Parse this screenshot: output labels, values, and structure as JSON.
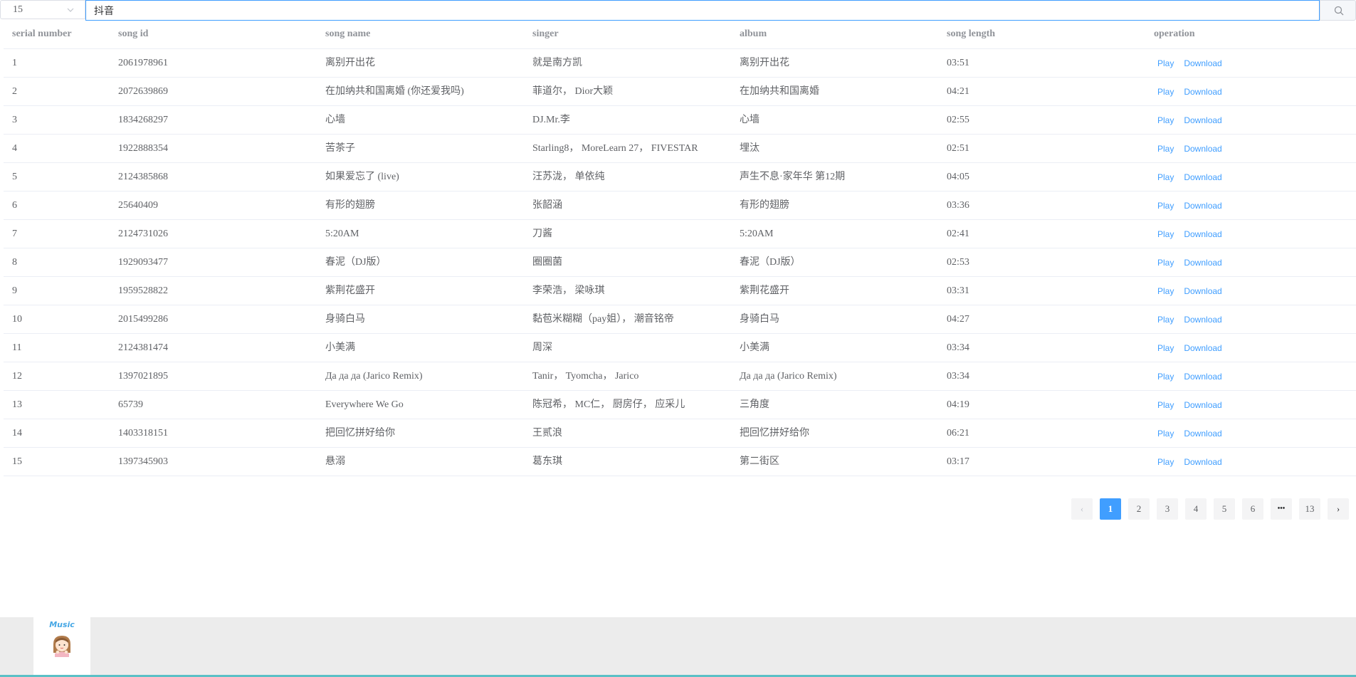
{
  "search": {
    "page_size_value": "15",
    "query": "抖音"
  },
  "table": {
    "headers": [
      "serial number",
      "song id",
      "song name",
      "singer",
      "album",
      "song length",
      "operation"
    ],
    "rows": [
      {
        "serial": "1",
        "id": "2061978961",
        "name": "离别开出花",
        "singer": "就是南方凯",
        "album": "离别开出花",
        "length": "03:51"
      },
      {
        "serial": "2",
        "id": "2072639869",
        "name": "在加纳共和国离婚 (你还爱我吗)",
        "singer": "菲道尔， Dior大颖",
        "album": "在加纳共和国离婚",
        "length": "04:21"
      },
      {
        "serial": "3",
        "id": "1834268297",
        "name": "心墙",
        "singer": "DJ.Mr.李",
        "album": "心墙",
        "length": "02:55"
      },
      {
        "serial": "4",
        "id": "1922888354",
        "name": "苦茶子",
        "singer": "Starling8， MoreLearn 27， FIVESTAR",
        "album": "埋汰",
        "length": "02:51"
      },
      {
        "serial": "5",
        "id": "2124385868",
        "name": "如果爱忘了 (live)",
        "singer": "汪苏泷， 单依纯",
        "album": "声生不息·家年华 第12期",
        "length": "04:05"
      },
      {
        "serial": "6",
        "id": "25640409",
        "name": "有形的翅膀",
        "singer": "张韶涵",
        "album": "有形的翅膀",
        "length": "03:36"
      },
      {
        "serial": "7",
        "id": "2124731026",
        "name": "5:20AM",
        "singer": "刀酱",
        "album": "5:20AM",
        "length": "02:41"
      },
      {
        "serial": "8",
        "id": "1929093477",
        "name": "春泥（DJ版）",
        "singer": "圈圈菌",
        "album": "春泥（DJ版）",
        "length": "02:53"
      },
      {
        "serial": "9",
        "id": "1959528822",
        "name": "紫荆花盛开",
        "singer": "李荣浩， 梁咏琪",
        "album": "紫荆花盛开",
        "length": "03:31"
      },
      {
        "serial": "10",
        "id": "2015499286",
        "name": "身骑白马",
        "singer": "黏苞米糊糊（pay姐）， 潮音铭帝",
        "album": "身骑白马",
        "length": "04:27"
      },
      {
        "serial": "11",
        "id": "2124381474",
        "name": "小美满",
        "singer": "周深",
        "album": "小美满",
        "length": "03:34"
      },
      {
        "serial": "12",
        "id": "1397021895",
        "name": "Да да да (Jarico Remix)",
        "singer": "Tanir， Tyomcha， Jarico",
        "album": "Да да да (Jarico Remix)",
        "length": "03:34"
      },
      {
        "serial": "13",
        "id": "65739",
        "name": "Everywhere We Go",
        "singer": "陈冠希， MC仁， 厨房仔， 应采儿",
        "album": "三角度",
        "length": "04:19"
      },
      {
        "serial": "14",
        "id": "1403318151",
        "name": "把回忆拼好给你",
        "singer": "王贰浪",
        "album": "把回忆拼好给你",
        "length": "06:21"
      },
      {
        "serial": "15",
        "id": "1397345903",
        "name": "悬溺",
        "singer": "葛东琪",
        "album": "第二街区",
        "length": "03:17"
      }
    ],
    "play_label": "Play",
    "download_label": "Download"
  },
  "pagination": {
    "prev": "‹",
    "pages": [
      "1",
      "2",
      "3",
      "4",
      "5",
      "6"
    ],
    "ellipsis": "•••",
    "last": "13",
    "next": "›",
    "current": "1"
  },
  "footer": {
    "logo_text": "Music"
  },
  "colors": {
    "accent": "#409eff",
    "footer_bg": "#ececec",
    "footer_line": "#5bc0c6"
  },
  "icons": {
    "select": "chevron-down-icon",
    "search": "search-icon"
  }
}
